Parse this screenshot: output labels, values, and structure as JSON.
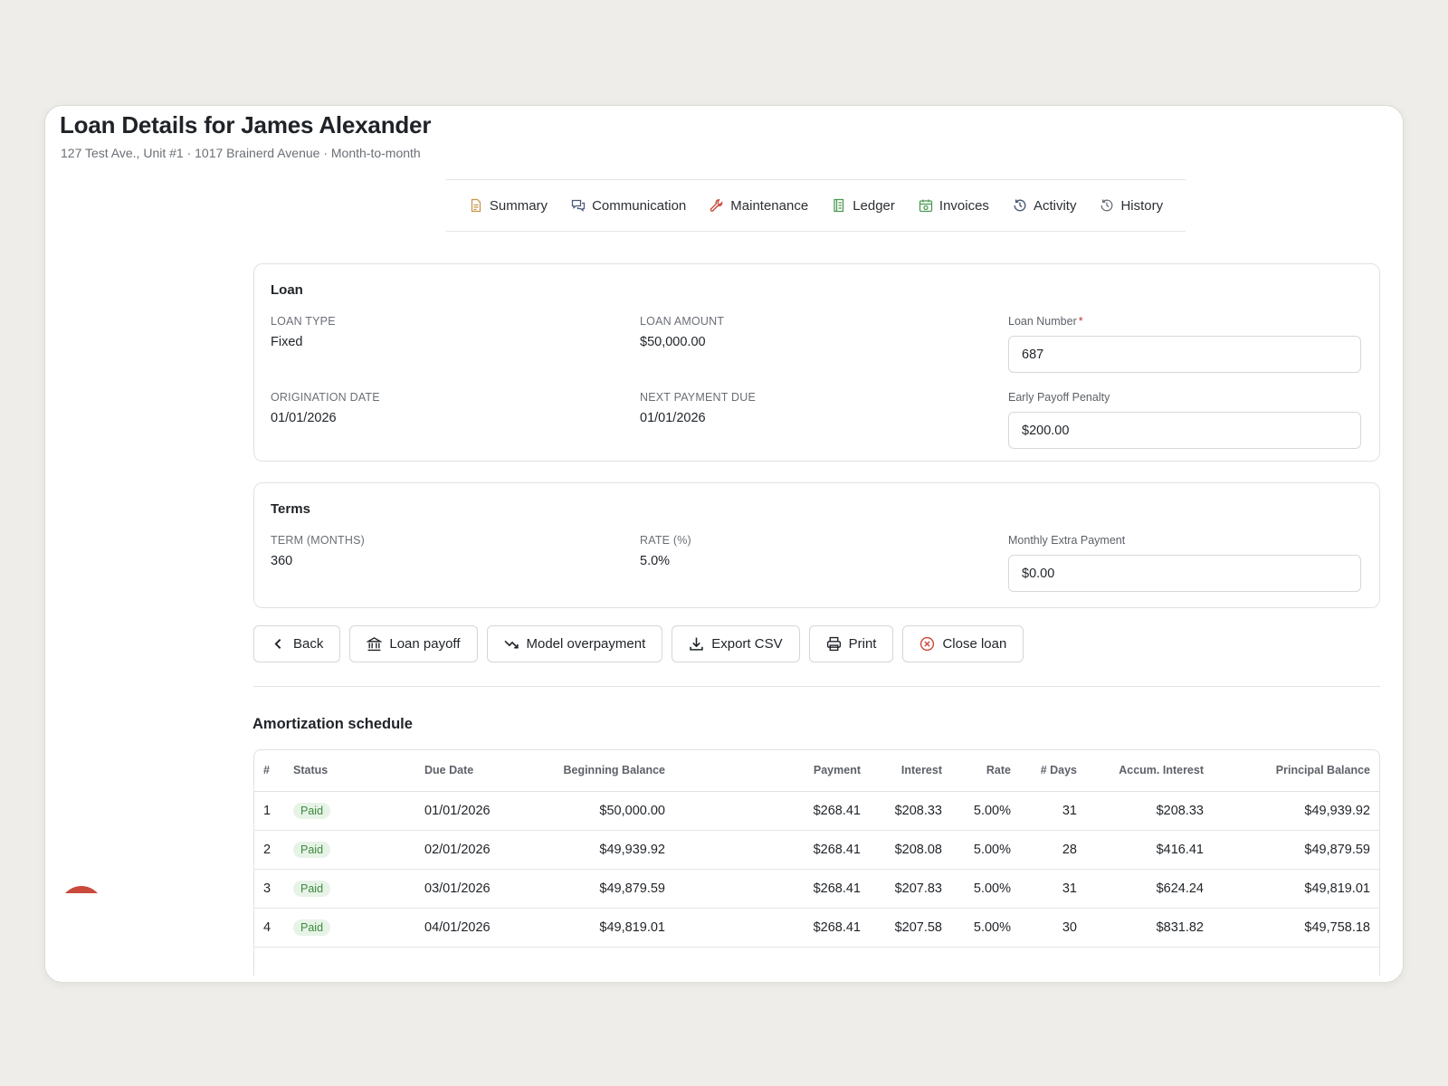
{
  "header": {
    "title": "Loan Details for James Alexander",
    "subtitle": "127 Test Ave., Unit #1 · 1017 Brainerd Avenue · Month-to-month"
  },
  "tabs": [
    {
      "label": "Summary",
      "icon": "document-icon"
    },
    {
      "label": "Communication",
      "icon": "chat-icon"
    },
    {
      "label": "Maintenance",
      "icon": "wrench-icon"
    },
    {
      "label": "Ledger",
      "icon": "ledger-icon"
    },
    {
      "label": "Invoices",
      "icon": "calendar-icon"
    },
    {
      "label": "Activity",
      "icon": "clock-history-icon"
    },
    {
      "label": "History",
      "icon": "clock-history-icon"
    }
  ],
  "loan": {
    "title": "Loan",
    "loan_type_label": "LOAN TYPE",
    "loan_type": "Fixed",
    "loan_amount_label": "LOAN AMOUNT",
    "loan_amount": "$50,000.00",
    "loan_number_label": "Loan Number",
    "loan_number_required": "*",
    "loan_number": "687",
    "origination_label": "ORIGINATION DATE",
    "origination_date": "01/01/2026",
    "next_payment_label": "NEXT PAYMENT DUE",
    "next_payment_due": "01/01/2026",
    "penalty_label": "Early Payoff Penalty",
    "penalty": "$200.00"
  },
  "terms": {
    "title": "Terms",
    "term_label": "TERM (MONTHS)",
    "term": "360",
    "rate_label": "RATE (%)",
    "rate": "5.0%",
    "extra_label": "Monthly Extra Payment",
    "extra": "$0.00"
  },
  "actions": {
    "back": "Back",
    "payoff": "Loan payoff",
    "model": "Model overpayment",
    "export": "Export CSV",
    "print": "Print",
    "close": "Close loan"
  },
  "colors": {
    "tab_icon_orange": "#c8964a",
    "tab_icon_blue": "#4a5a78",
    "tab_icon_red": "#c9493b",
    "tab_icon_green": "#4c9a52",
    "paid_badge_bg": "#e7f3e6",
    "paid_badge_text": "#3d8a40",
    "close_icon": "#d0443a"
  },
  "schedule": {
    "title": "Amortization schedule",
    "columns": [
      "#",
      "Status",
      "Due Date",
      "Beginning Balance",
      "Payment",
      "Interest",
      "Rate",
      "# Days",
      "Accum. Interest",
      "Principal Balance"
    ],
    "rows": [
      [
        "1",
        "Paid",
        "01/01/2026",
        "$50,000.00",
        "$268.41",
        "$208.33",
        "5.00%",
        "31",
        "$208.33",
        "$49,939.92"
      ],
      [
        "2",
        "Paid",
        "02/01/2026",
        "$49,939.92",
        "$268.41",
        "$208.08",
        "5.00%",
        "28",
        "$416.41",
        "$49,879.59"
      ],
      [
        "3",
        "Paid",
        "03/01/2026",
        "$49,879.59",
        "$268.41",
        "$207.83",
        "5.00%",
        "31",
        "$624.24",
        "$49,819.01"
      ],
      [
        "4",
        "Paid",
        "04/01/2026",
        "$49,819.01",
        "$268.41",
        "$207.58",
        "5.00%",
        "30",
        "$831.82",
        "$49,758.18"
      ]
    ]
  }
}
